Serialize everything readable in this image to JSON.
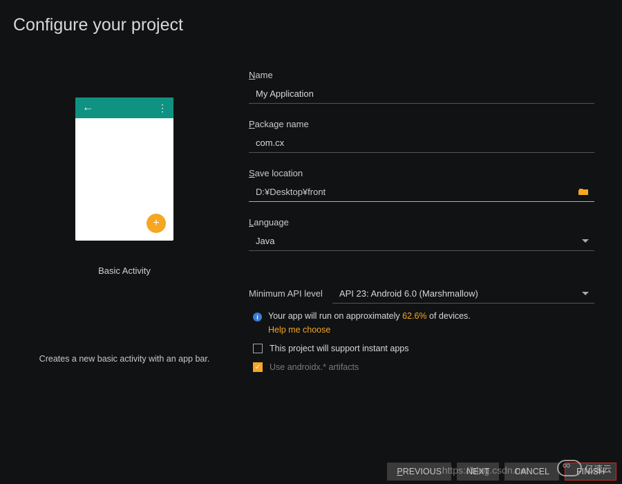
{
  "page_title": "Configure your project",
  "preview": {
    "template_name": "Basic Activity",
    "template_desc": "Creates a new basic activity with an app bar."
  },
  "form": {
    "name_label_pre": "N",
    "name_label_post": "ame",
    "name_value": "My Application",
    "package_label_pre": "P",
    "package_label_post": "ackage name",
    "package_value": "com.cx",
    "save_label_pre": "S",
    "save_label_post": "ave location",
    "save_value": "D:¥Desktop¥front",
    "language_label_pre": "L",
    "language_label_post": "anguage",
    "language_value": "Java",
    "api_label": "Minimum API level",
    "api_value": "API 23: Android 6.0 (Marshmallow)",
    "info_pre": "Your app will run on approximately ",
    "info_percent": "62.6%",
    "info_post": " of devices.",
    "help_link": "Help me choose",
    "instant_apps_label": "This project will support instant apps",
    "androidx_label": "Use androidx.* artifacts"
  },
  "buttons": {
    "previous_pre": "P",
    "previous_post": "REVIOUS",
    "next": "NEXT",
    "cancel": "CANCEL",
    "finish": "FINISH"
  },
  "watermark_csdn": "https://blog.csdn.net",
  "watermark_yisu": "亿速云"
}
